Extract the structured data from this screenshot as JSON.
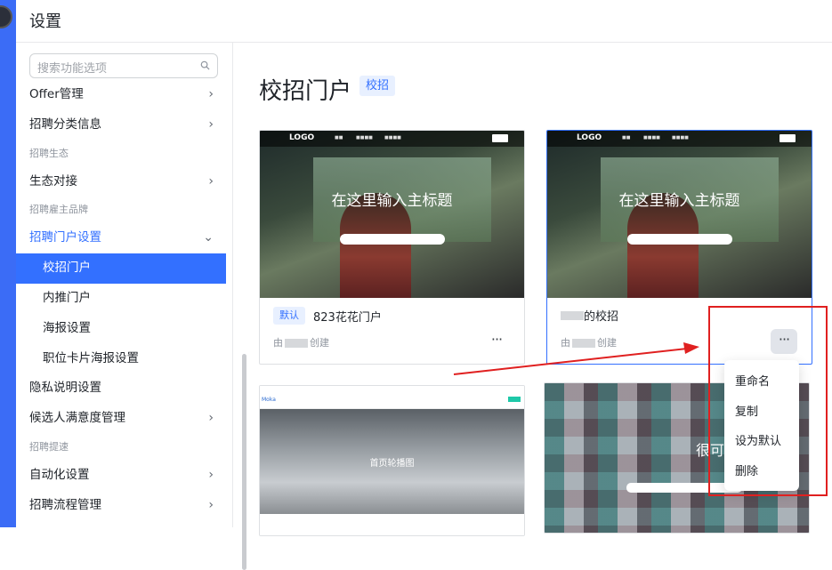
{
  "header": {
    "title": "设置"
  },
  "search": {
    "placeholder": "搜索功能选项"
  },
  "menu": [
    {
      "label": "Offer管理",
      "kind": "item",
      "chev": "›"
    },
    {
      "label": "招聘分类信息",
      "kind": "item",
      "chev": "›"
    },
    {
      "label": "招聘生态",
      "kind": "sec"
    },
    {
      "label": "生态对接",
      "kind": "item",
      "chev": "›"
    },
    {
      "label": "招聘雇主品牌",
      "kind": "sec"
    },
    {
      "label": "招聘门户设置",
      "kind": "open",
      "chev": "⌄"
    },
    {
      "label": "校招门户",
      "kind": "active"
    },
    {
      "label": "内推门户",
      "kind": "sub"
    },
    {
      "label": "海报设置",
      "kind": "sub"
    },
    {
      "label": "职位卡片海报设置",
      "kind": "sub"
    },
    {
      "label": "隐私说明设置",
      "kind": "item"
    },
    {
      "label": "候选人满意度管理",
      "kind": "item",
      "chev": "›"
    },
    {
      "label": "招聘提速",
      "kind": "sec"
    },
    {
      "label": "自动化设置",
      "kind": "item",
      "chev": "›"
    },
    {
      "label": "招聘流程管理",
      "kind": "item",
      "chev": "›"
    }
  ],
  "main": {
    "title": "校招门户",
    "badge": "校招"
  },
  "cards": [
    {
      "thumb_logo": "LOGO",
      "headline": "在这里输入主标题",
      "tag": "默认",
      "name": "823花花门户",
      "by": "由",
      "created": "创建",
      "more": "···"
    },
    {
      "thumb_logo": "LOGO",
      "headline": "在这里输入主标题",
      "name": "的校招",
      "by": "由",
      "created": "创建",
      "more": "···"
    },
    {
      "thumb_logo": "Moka",
      "headline": "首页轮播图"
    },
    {
      "headline": "很可"
    }
  ],
  "dropdown": {
    "items": [
      "重命名",
      "复制",
      "设为默认",
      "删除"
    ]
  },
  "colors": {
    "accent": "#3370ff",
    "rail": "#3b6cf6",
    "annotation": "#e02020"
  }
}
